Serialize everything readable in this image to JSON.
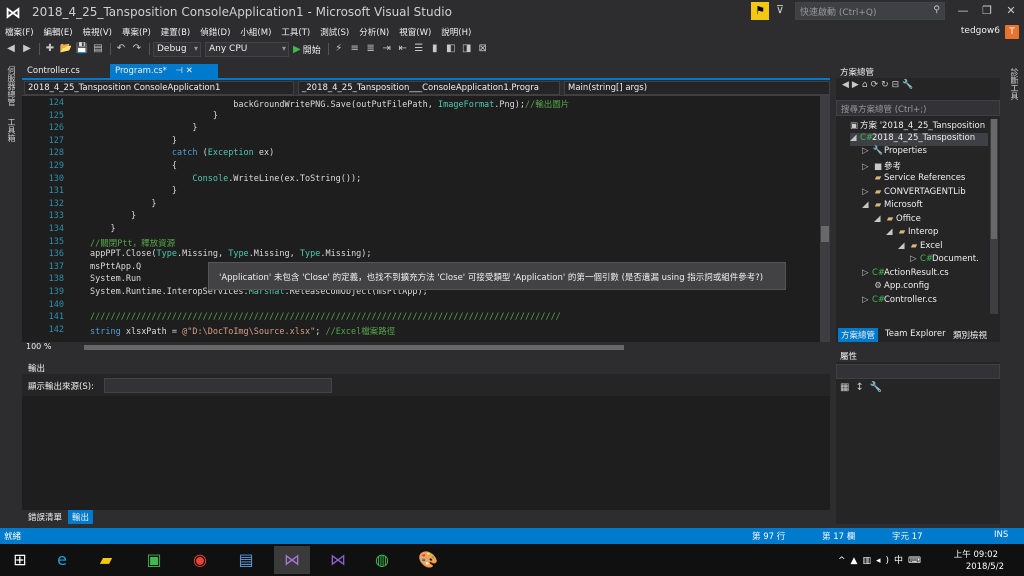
{
  "window": {
    "title": "2018_4_25_Tansposition    ConsoleApplication1 - Microsoft Visual Studio",
    "quick_launch_placeholder": "快速啟動 (Ctrl+Q)",
    "user": "tedgow6",
    "user_initial": "T"
  },
  "menu": [
    "檔案(F)",
    "編輯(E)",
    "檢視(V)",
    "專案(P)",
    "建置(B)",
    "偵錯(D)",
    "小組(M)",
    "工具(T)",
    "測試(S)",
    "分析(N)",
    "視窗(W)",
    "說明(H)"
  ],
  "toolbar": {
    "config": "Debug",
    "platform": "Any CPU",
    "start": "開始"
  },
  "left_strip": [
    "伺服器總管",
    "工具箱"
  ],
  "editor": {
    "tabs": [
      "Controller.cs",
      "Program.cs*"
    ],
    "nav_project": "2018_4_25_Tansposition  ConsoleApplication1",
    "nav_class": "_2018_4_25_Tansposition___ConsoleApplication1.Progra",
    "nav_member": "Main(string[] args)",
    "zoom": "100 %",
    "lines": [
      {
        "n": "124",
        "html": "                            backGroundWritePNG.Save(outPutFilePath, <span class=\"ty\">ImageFormat</span>.Png);<span class=\"cm\">//輸出圖片</span>"
      },
      {
        "n": "125",
        "html": "                        }"
      },
      {
        "n": "126",
        "html": "                    }"
      },
      {
        "n": "127",
        "html": "                }"
      },
      {
        "n": "128",
        "html": "                <span class=\"kw\">catch</span> (<span class=\"ty\">Exception</span> ex)"
      },
      {
        "n": "129",
        "html": "                {"
      },
      {
        "n": "130",
        "html": "                    <span class=\"ty\">Console</span>.WriteLine(ex.ToString());"
      },
      {
        "n": "131",
        "html": "                }"
      },
      {
        "n": "132",
        "html": "            }"
      },
      {
        "n": "133",
        "html": "        }"
      },
      {
        "n": "134",
        "html": "    }"
      },
      {
        "n": "135",
        "html": "<span class=\"cm\">//關閉Ptt，釋放資源</span>"
      },
      {
        "n": "136",
        "html": "appPPT.Close(<span class=\"ty\">Type</span>.Missing, <span class=\"ty\">Type</span>.Missing, <span class=\"ty\">Type</span>.Missing);"
      },
      {
        "n": "137",
        "html": "msPttApp.Q"
      },
      {
        "n": "138",
        "html": "System.Run"
      },
      {
        "n": "139",
        "html": "System.Runtime.InteropServices.<span class=\"ty\">Marshal</span>.ReleaseComObject(msPttApp);"
      },
      {
        "n": "140",
        "html": ""
      },
      {
        "n": "141",
        "html": "<span class=\"cm\">////////////////////////////////////////////////////////////////////////////////////////////</span>"
      },
      {
        "n": "142",
        "html": "<span class=\"kw\">string</span> xlsxPath = <span class=\"str\">@\"D:\\DocToImg\\Source.xlsx\"</span>; <span class=\"cm\">//Excel檔案路徑</span>"
      }
    ],
    "tooltip": "'Application' 未包含 'Close' 的定義，也找不到擴充方法 'Close' 可接受類型 'Application' 的第一個引數 (是否遺漏 using 指示詞或組件參考?)"
  },
  "output": {
    "title": "輸出",
    "source_label": "顯示輸出來源(S):",
    "bottom_tabs": [
      "錯誤清單",
      "輸出"
    ]
  },
  "solution_explorer": {
    "title": "方案總管",
    "search_placeholder": "搜尋方案總管 (Ctrl+;)",
    "tree": [
      {
        "indent": 0,
        "twist": "",
        "icon": "▣",
        "cls": "cfg",
        "label": "方案 '2018_4_25_Tansposition",
        "sel": false
      },
      {
        "indent": 1,
        "twist": "◢",
        "icon": "C#",
        "cls": "cs",
        "label": "2018_4_25_Tansposition",
        "sel": true
      },
      {
        "indent": 2,
        "twist": "▷",
        "icon": "🔧",
        "cls": "cfg",
        "label": "Properties",
        "sel": false
      },
      {
        "indent": 2,
        "twist": "▷",
        "icon": "■",
        "cls": "cfg",
        "label": "參考",
        "sel": false
      },
      {
        "indent": 2,
        "twist": "",
        "icon": "▰",
        "cls": "fold",
        "label": "Service References",
        "sel": false
      },
      {
        "indent": 2,
        "twist": "▷",
        "icon": "▰",
        "cls": "fold",
        "label": "CONVERTAGENTLib",
        "sel": false
      },
      {
        "indent": 2,
        "twist": "◢",
        "icon": "▰",
        "cls": "fold",
        "label": "Microsoft",
        "sel": false
      },
      {
        "indent": 3,
        "twist": "◢",
        "icon": "▰",
        "cls": "fold",
        "label": "Office",
        "sel": false
      },
      {
        "indent": 4,
        "twist": "◢",
        "icon": "▰",
        "cls": "fold",
        "label": "Interop",
        "sel": false
      },
      {
        "indent": 5,
        "twist": "◢",
        "icon": "▰",
        "cls": "fold",
        "label": "Excel",
        "sel": false
      },
      {
        "indent": 6,
        "twist": "▷",
        "icon": "C#",
        "cls": "cs",
        "label": "Document.",
        "sel": false
      },
      {
        "indent": 2,
        "twist": "▷",
        "icon": "C#",
        "cls": "cs",
        "label": "ActionResult.cs",
        "sel": false
      },
      {
        "indent": 2,
        "twist": "",
        "icon": "⚙",
        "cls": "cfg",
        "label": "App.config",
        "sel": false
      },
      {
        "indent": 2,
        "twist": "▷",
        "icon": "C#",
        "cls": "cs",
        "label": "Controller.cs",
        "sel": false
      }
    ],
    "tabs": [
      "方案總管",
      "Team Explorer",
      "類別檢視"
    ]
  },
  "properties": {
    "title": "屬性"
  },
  "right_strip": [
    "診斷工具"
  ],
  "status": {
    "ready": "就緒",
    "line": "第 97 行",
    "col": "第 17 欄",
    "char": "字元 17",
    "ins": "INS"
  },
  "taskbar": {
    "time": "上午 09:02",
    "date": "2018/5/2",
    "ime": "中"
  }
}
